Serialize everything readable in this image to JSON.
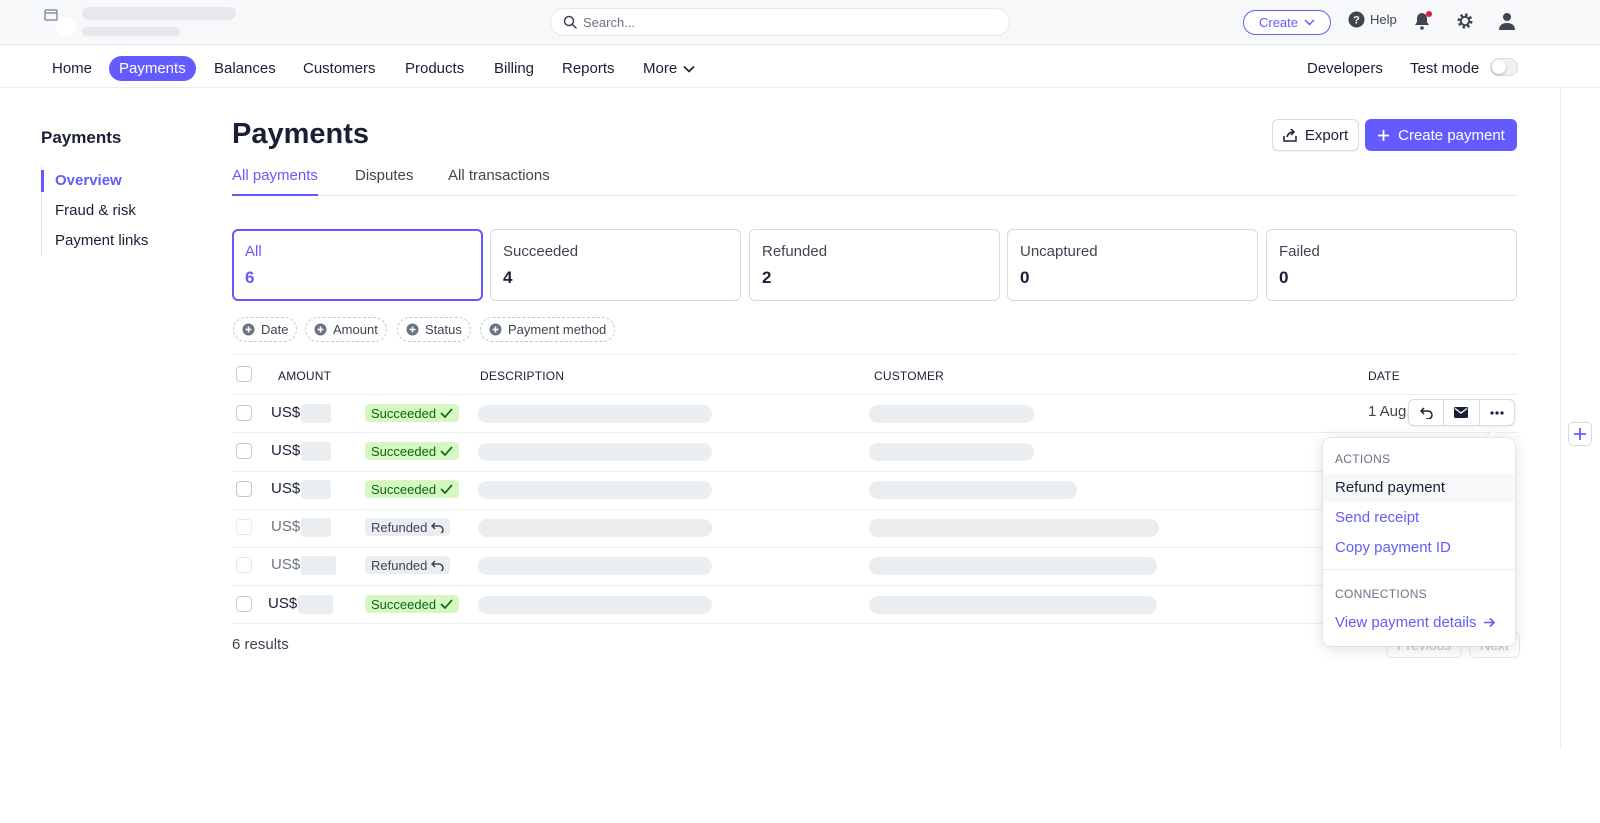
{
  "topbar": {
    "search_placeholder": "Search...",
    "create_label": "Create",
    "help_label": "Help"
  },
  "nav": {
    "items": [
      "Home",
      "Payments",
      "Balances",
      "Customers",
      "Products",
      "Billing",
      "Reports",
      "More"
    ],
    "active": "Payments",
    "developers": "Developers",
    "test_mode": "Test mode",
    "test_mode_on": false
  },
  "sidebar": {
    "title": "Payments",
    "items": [
      "Overview",
      "Fraud & risk",
      "Payment links"
    ],
    "active": "Overview"
  },
  "page": {
    "title": "Payments",
    "export_label": "Export",
    "create_payment_label": "Create payment"
  },
  "tabs": [
    "All payments",
    "Disputes",
    "All transactions"
  ],
  "summary_cards": [
    {
      "label": "All",
      "count": "6"
    },
    {
      "label": "Succeeded",
      "count": "4"
    },
    {
      "label": "Refunded",
      "count": "2"
    },
    {
      "label": "Uncaptured",
      "count": "0"
    },
    {
      "label": "Failed",
      "count": "0"
    }
  ],
  "filters": [
    "Date",
    "Amount",
    "Status",
    "Payment method"
  ],
  "table": {
    "columns": [
      "AMOUNT",
      "DESCRIPTION",
      "CUSTOMER",
      "DATE"
    ],
    "rows": [
      {
        "currency": "US$",
        "status": "Succeeded",
        "date": "1 Aug,"
      },
      {
        "currency": "US$",
        "status": "Succeeded",
        "date": ""
      },
      {
        "currency": "US$",
        "status": "Succeeded",
        "date": ""
      },
      {
        "currency": "US$",
        "status": "Refunded",
        "date": ""
      },
      {
        "currency": "US$",
        "status": "Refunded",
        "date": ""
      },
      {
        "currency": "US$",
        "status": "Succeeded",
        "date": ""
      }
    ]
  },
  "results_text": "6 results",
  "pagination": {
    "previous": "Previous",
    "next": "Next"
  },
  "dropdown": {
    "actions_header": "ACTIONS",
    "actions": [
      "Refund payment",
      "Send receipt",
      "Copy payment ID"
    ],
    "connections_header": "CONNECTIONS",
    "connections": [
      "View payment details"
    ]
  },
  "colors": {
    "accent": "#635bff",
    "success_bg": "#d7f7c2",
    "success_fg": "#05690d"
  },
  "icons": [
    "store-icon",
    "search-icon",
    "chevron-down-icon",
    "help-icon",
    "bell-icon",
    "gear-icon",
    "user-icon",
    "export-icon",
    "plus-icon",
    "plus-circle-icon",
    "check-icon",
    "refund-icon",
    "mail-icon",
    "more-icon",
    "arrow-right-icon"
  ]
}
